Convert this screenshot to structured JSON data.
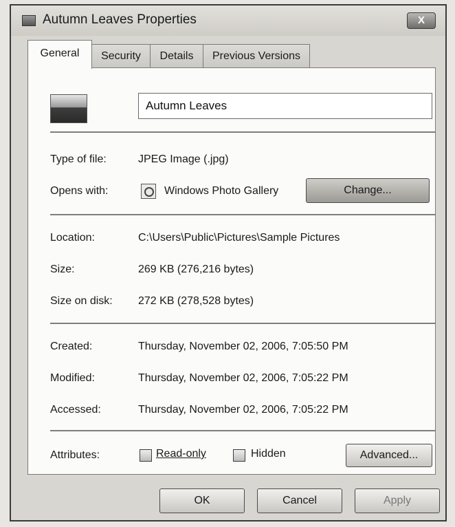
{
  "window": {
    "title": "Autumn Leaves Properties",
    "close_label": "X"
  },
  "tabs": [
    {
      "label": "General",
      "active": true
    },
    {
      "label": "Security",
      "active": false
    },
    {
      "label": "Details",
      "active": false
    },
    {
      "label": "Previous Versions",
      "active": false
    }
  ],
  "general": {
    "file_name": "Autumn Leaves",
    "type_label": "Type of file:",
    "type_value": "JPEG Image (.jpg)",
    "opens_label": "Opens with:",
    "opens_value": "Windows Photo Gallery",
    "change_button": "Change...",
    "location_label": "Location:",
    "location_value": "C:\\Users\\Public\\Pictures\\Sample Pictures",
    "size_label": "Size:",
    "size_value": "269 KB (276,216 bytes)",
    "size_on_disk_label": "Size on disk:",
    "size_on_disk_value": "272 KB (278,528 bytes)",
    "created_label": "Created:",
    "created_value": "Thursday, November 02, 2006, 7:05:50 PM",
    "modified_label": "Modified:",
    "modified_value": "Thursday, November 02, 2006, 7:05:22 PM",
    "accessed_label": "Accessed:",
    "accessed_value": "Thursday, November 02, 2006, 7:05:22 PM",
    "attributes_label": "Attributes:",
    "readonly_label": "Read-only",
    "readonly_checked": false,
    "hidden_label": "Hidden",
    "hidden_checked": false,
    "advanced_button": "Advanced..."
  },
  "footer": {
    "ok_button": "OK",
    "cancel_button": "Cancel",
    "apply_button": "Apply"
  },
  "icons": {
    "title": "image-file-icon",
    "file": "landscape-image-icon",
    "app": "photo-gallery-icon"
  }
}
